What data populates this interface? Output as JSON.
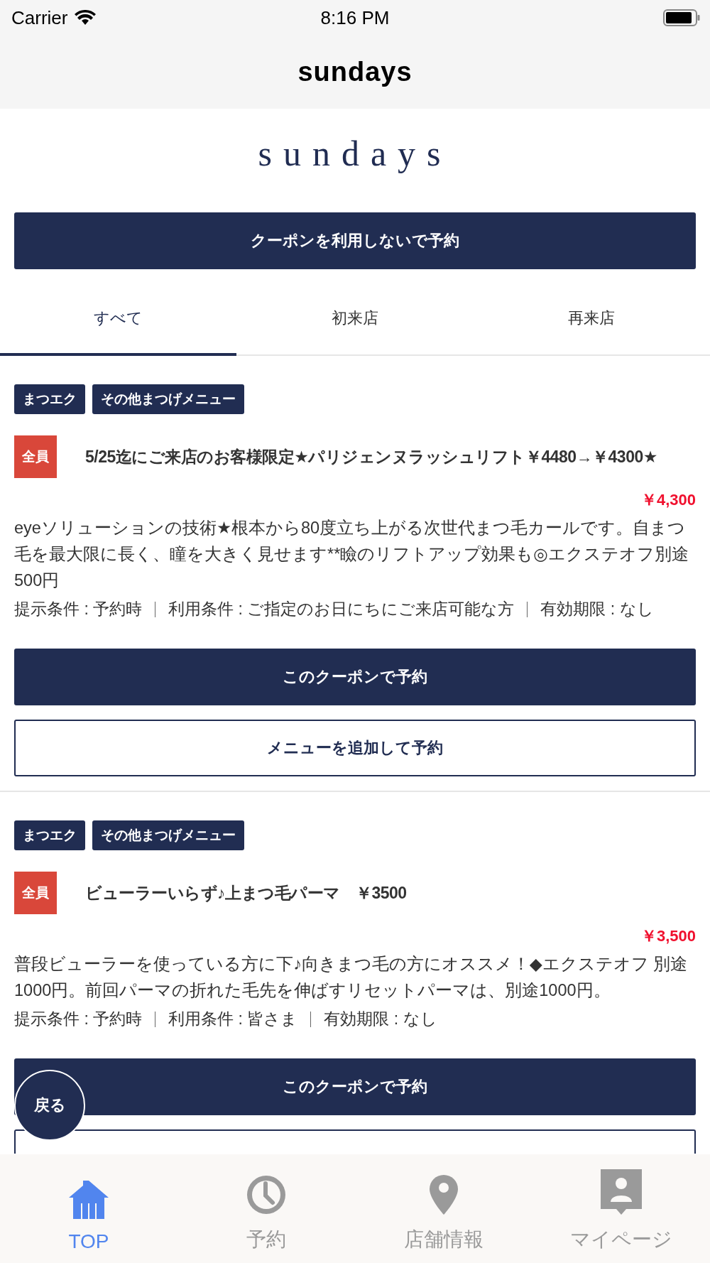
{
  "status_bar": {
    "carrier": "Carrier",
    "time": "8:16 PM"
  },
  "nav_bar": {
    "title": "sundays"
  },
  "logo": "sundays",
  "reserve_button": "クーポンを利用しないで予約",
  "tabs": [
    {
      "label": "すべて",
      "selected": true
    },
    {
      "label": "初来店",
      "selected": false
    },
    {
      "label": "再来店",
      "selected": false
    }
  ],
  "coupons": [
    {
      "tags": [
        "まつエク",
        "その他まつげメニュー"
      ],
      "badge": "全員",
      "title": "5/25迄にご来店のお客様限定★パリジェンヌラッシュリフト￥4480→￥4300★",
      "price": "￥4,300",
      "description": "eyeソリューションの技術★根本から80度立ち上がる次世代まつ毛カールです。自まつ毛を最大限に長く、瞳を大きく見せます**瞼のリフトアップ効果も◎エクステオフ別途500円",
      "conditions": [
        "提示条件 : 予約時",
        "利用条件 : ご指定のお日にちにご来店可能な方",
        "有効期限 : なし"
      ],
      "book_button": "このクーポンで予約",
      "add_menu_button": "メニューを追加して予約"
    },
    {
      "tags": [
        "まつエク",
        "その他まつげメニュー"
      ],
      "badge": "全員",
      "title": "ビューラーいらず♪上まつ毛パーマ　￥3500",
      "price": "￥3,500",
      "description": "普段ビューラーを使っている方に下♪向きまつ毛の方にオススメ！◆エクステオフ 別途1000円。前回パーマの折れた毛先を伸ばすリセットパーマは、別途1000円。",
      "conditions": [
        "提示条件 : 予約時",
        "利用条件 : 皆さま",
        "有効期限 : なし"
      ],
      "book_button": "このクーポンで予約"
    }
  ],
  "back_button": "戻る",
  "tab_bar": [
    {
      "label": "TOP",
      "selected": true
    },
    {
      "label": "予約",
      "selected": false
    },
    {
      "label": "店舗情報",
      "selected": false
    },
    {
      "label": "マイページ",
      "selected": false
    }
  ]
}
